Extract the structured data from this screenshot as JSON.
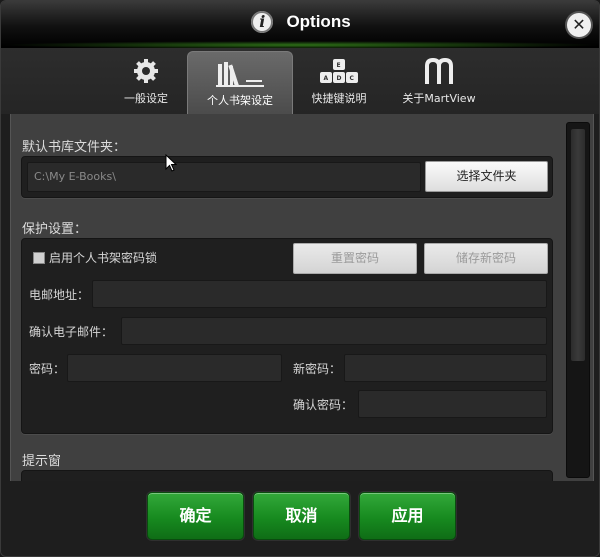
{
  "window": {
    "title": "Options"
  },
  "tabs": [
    {
      "label": "一般设定",
      "icon": "gear-icon"
    },
    {
      "label": "个人书架设定",
      "icon": "bookshelf-icon",
      "active": true
    },
    {
      "label": "快捷键说明",
      "icon": "keyboard-icon"
    },
    {
      "label": "关于MartView",
      "icon": "martview-logo-icon"
    }
  ],
  "library": {
    "section_label": "默认书库文件夹：",
    "path_value": "C:\\My E-Books\\",
    "choose_folder_button": "选择文件夹"
  },
  "protection": {
    "section_label": "保护设置：",
    "lock_checkbox_label": "启用个人书架密码锁",
    "lock_checked": false,
    "reset_password_button": "重置密码",
    "save_new_password_button": "储存新密码",
    "email_label": "电邮地址：",
    "confirm_email_label": "确认电子邮件：",
    "password_label": "密码：",
    "new_password_label": "新密码：",
    "confirm_password_label": "确认密码："
  },
  "hint_window": {
    "section_label": "提示窗"
  },
  "footer": {
    "ok_button": "确定",
    "cancel_button": "取消",
    "apply_button": "应用"
  },
  "colors": {
    "accent_green": "#178a1f",
    "background": "#404040"
  }
}
